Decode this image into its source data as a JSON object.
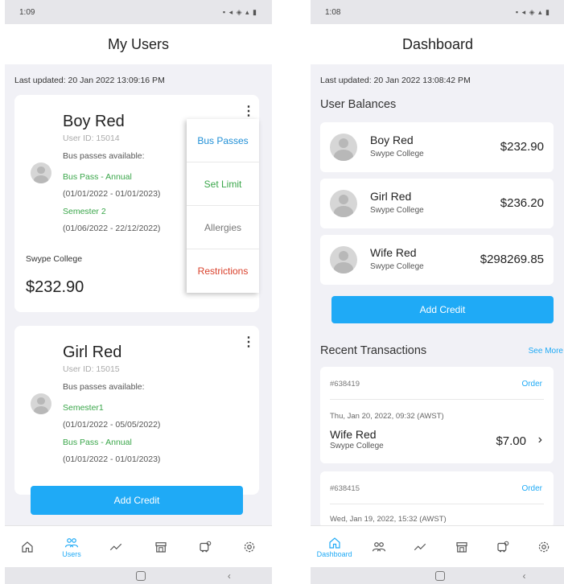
{
  "left_screen": {
    "status_time": "1:09",
    "title": "My Users",
    "last_updated": "Last updated: 20 Jan 2022 13:09:16 PM",
    "users": [
      {
        "name": "Boy Red",
        "user_id": "User ID: 15014",
        "passes_label": "Bus passes available:",
        "passes": [
          {
            "name": "Bus Pass - Annual",
            "dates": "(01/01/2022 - 01/01/2023)"
          },
          {
            "name": "Semester 2",
            "dates": "(01/06/2022 - 22/12/2022)"
          }
        ],
        "school": "Swype College",
        "balance": "$232.90"
      },
      {
        "name": "Girl Red",
        "user_id": "User ID: 15015",
        "passes_label": "Bus passes available:",
        "passes": [
          {
            "name": "Semester1",
            "dates": "(01/01/2022 - 05/05/2022)"
          },
          {
            "name": "Bus Pass - Annual",
            "dates": "(01/01/2022 - 01/01/2023)"
          }
        ]
      }
    ],
    "menu": [
      {
        "label": "Bus Passes",
        "color": "#1f8fd6"
      },
      {
        "label": "Set Limit",
        "color": "#3aa64a"
      },
      {
        "label": "Allergies",
        "color": "#777777"
      },
      {
        "label": "Restrictions",
        "color": "#d9402b"
      }
    ],
    "add_credit": "Add Credit",
    "nav_users_label": "Users"
  },
  "right_screen": {
    "status_time": "1:08",
    "title": "Dashboard",
    "last_updated": "Last updated: 20 Jan 2022 13:08:42 PM",
    "balances_title": "User Balances",
    "balances": [
      {
        "name": "Boy Red",
        "school": "Swype College",
        "amount": "$232.90"
      },
      {
        "name": "Girl Red",
        "school": "Swype College",
        "amount": "$236.20"
      },
      {
        "name": "Wife Red",
        "school": "Swype College",
        "amount": "$298269.85"
      }
    ],
    "add_credit": "Add Credit",
    "transactions_title": "Recent Transactions",
    "see_more": "See More",
    "transactions": [
      {
        "id": "#638419",
        "type": "Order",
        "date": "Thu, Jan 20, 2022, 09:32 (AWST)",
        "name": "Wife Red",
        "school": "Swype College",
        "amount": "$7.00"
      },
      {
        "id": "#638415",
        "type": "Order",
        "date": "Wed, Jan 19, 2022, 15:32 (AWST)"
      }
    ],
    "nav_dashboard_label": "Dashboard"
  },
  "colors": {
    "accent": "#1faaf6",
    "green": "#3aa64a",
    "red": "#d9402b"
  }
}
